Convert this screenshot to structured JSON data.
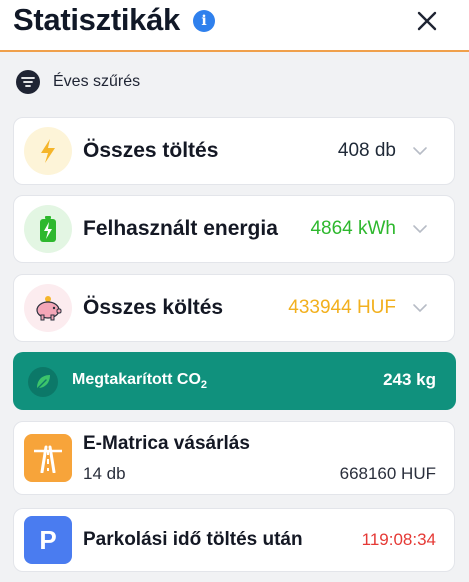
{
  "header": {
    "title": "Statisztikák",
    "info_icon": "i"
  },
  "filter": {
    "label": "Éves szűrés"
  },
  "stats": [
    {
      "label": "Összes töltés",
      "value": "408 db",
      "icon": "lightning-icon",
      "color": "#1f2937"
    },
    {
      "label": "Felhasznált energia",
      "value": "4864 kWh",
      "icon": "battery-icon",
      "color": "#2eb82e"
    },
    {
      "label": "Összes költés",
      "value": "433944 HUF",
      "icon": "piggy-bank-icon",
      "color": "#f2b01e"
    }
  ],
  "co2": {
    "label": "Megtakarított CO",
    "subscript": "2",
    "value": "243 kg"
  },
  "vignette": {
    "title": "E-Matrica vásárlás",
    "count": "14 db",
    "price": "668160 HUF"
  },
  "parking": {
    "label": "Parkolási idő töltés után",
    "value": "119:08:34",
    "icon_letter": "P"
  },
  "colors": {
    "accent": "#f0a04b",
    "teal": "#10917d",
    "info": "#2f80ed"
  }
}
